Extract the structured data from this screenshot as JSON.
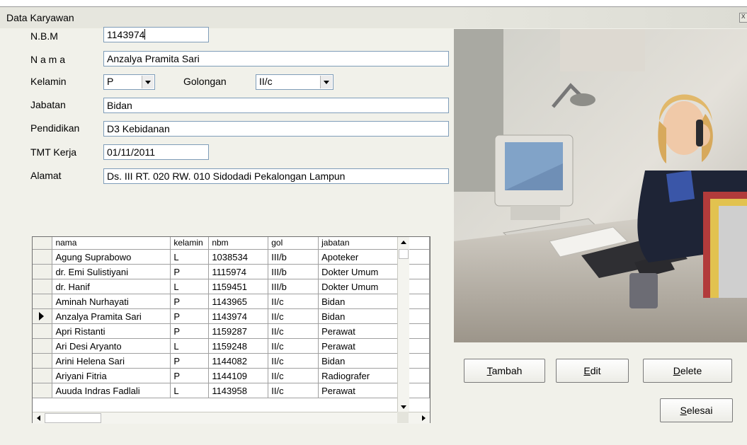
{
  "window": {
    "title": "Data Karyawan"
  },
  "form": {
    "nbm_label": "N.B.M",
    "nbm_value": "1143974",
    "nama_label": "N a m a",
    "nama_value": "Anzalya Pramita Sari",
    "kelamin_label": "Kelamin",
    "kelamin_value": "P",
    "golongan_label": "Golongan",
    "golongan_value": "II/c",
    "jabatan_label": "Jabatan",
    "jabatan_value": "Bidan",
    "pendidikan_label": "Pendidikan",
    "pendidikan_value": "D3 Kebidanan",
    "tmt_label": "TMT Kerja",
    "tmt_value": "01/11/2011",
    "alamat_label": "Alamat",
    "alamat_value": "Ds. III RT. 020 RW. 010 Sidodadi Pekalongan Lampun"
  },
  "grid": {
    "columns": [
      "nama",
      "kelamin",
      "nbm",
      "gol",
      "jabatan"
    ],
    "rows": [
      [
        "Agung Suprabowo",
        "L",
        "1038534",
        "III/b",
        "Apoteker"
      ],
      [
        "dr. Emi Sulistiyani",
        "P",
        "1115974",
        "III/b",
        "Dokter Umum"
      ],
      [
        "dr. Hanif",
        "L",
        "1159451",
        "III/b",
        "Dokter Umum"
      ],
      [
        "Aminah Nurhayati",
        "P",
        "1143965",
        "II/c",
        "Bidan"
      ],
      [
        "Anzalya Pramita Sari",
        "P",
        "1143974",
        "II/c",
        "Bidan"
      ],
      [
        "Apri Ristanti",
        "P",
        "1159287",
        "II/c",
        "Perawat"
      ],
      [
        "Ari Desi Aryanto",
        "L",
        "1159248",
        "II/c",
        "Perawat"
      ],
      [
        "Arini Helena Sari",
        "P",
        "1144082",
        "II/c",
        "Bidan"
      ],
      [
        "Ariyani Fitria",
        "P",
        "1144109",
        "II/c",
        "Radiografer"
      ],
      [
        "Auuda Indras Fadlali",
        "L",
        "1143958",
        "II/c",
        "Perawat"
      ]
    ],
    "current_row": 5
  },
  "buttons": {
    "tambah": {
      "mnemonic": "T",
      "rest": "ambah"
    },
    "edit": {
      "mnemonic": "E",
      "rest": "dit"
    },
    "delete": {
      "mnemonic": "D",
      "rest": "elete"
    },
    "selesai": {
      "mnemonic": "S",
      "rest": "elesai"
    }
  }
}
